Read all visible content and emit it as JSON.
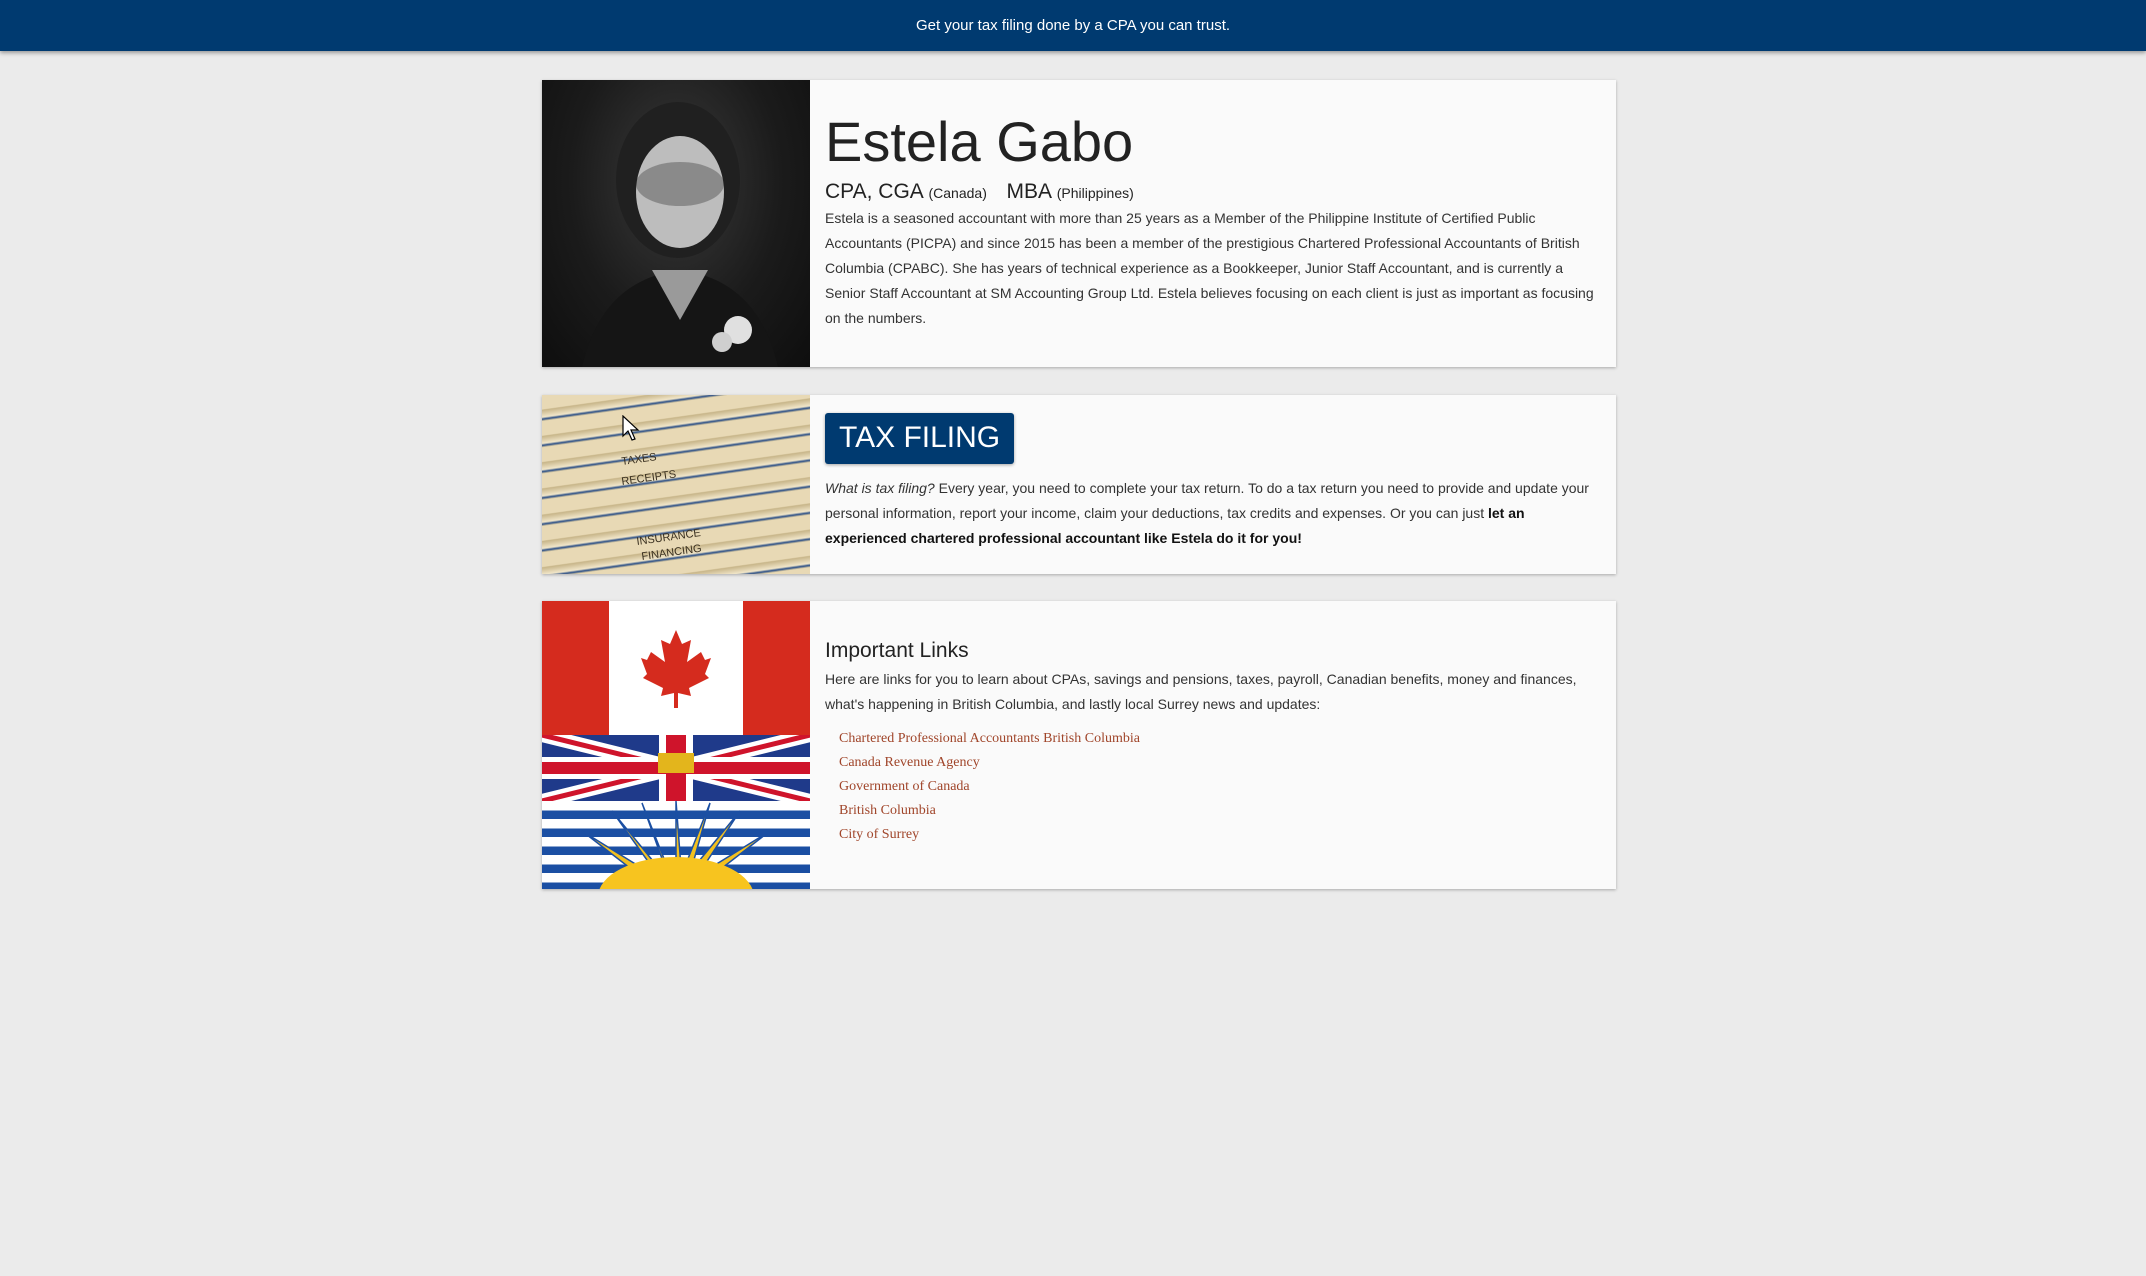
{
  "banner": {
    "text": "Get your tax filing done by a CPA you can trust."
  },
  "bio": {
    "name": "Estela Gabo",
    "credential1": "CPA, CGA",
    "credential1_note": "(Canada)",
    "credential2": "MBA",
    "credential2_note": "(Philippines)",
    "description": "Estela is a seasoned accountant with more than 25 years as a Member of the Philippine Institute of Certified Public Accountants (PICPA) and since 2015 has been a member of the prestigious Chartered Professional Accountants of British Columbia (CPABC). She has years of technical experience as a Bookkeeper, Junior Staff Accountant, and is currently a Senior Staff Accountant at SM Accounting Group Ltd. Estela believes focusing on each client is just as important as focusing on the numbers."
  },
  "tax": {
    "badge": "TAX FILING",
    "question": "What is tax filing?",
    "body": " Every year, you need to complete your tax return. To do a tax return you need to provide and update your personal information, report your income, claim your deductions, tax credits and expenses. Or you can just ",
    "emphasis": "let an experienced chartered professional accountant like Estela do it for you!",
    "folder_labels": [
      "TAXES",
      "RECEIPTS",
      "INSURANCE",
      "FINANCING"
    ]
  },
  "links": {
    "title": "Important Links",
    "intro": "Here are links for you to learn about CPAs, savings and pensions, taxes, payroll, Canadian benefits, money and finances, what's happening in British Columbia, and lastly local Surrey news and updates:",
    "items": [
      "Chartered Professional Accountants British Columbia",
      "Canada Revenue Agency",
      "Government of Canada",
      "British Columbia",
      "City of Surrey"
    ]
  },
  "colors": {
    "brand": "#003a70",
    "link": "#a0452a",
    "background": "#ebebeb",
    "card": "#fafafa"
  }
}
